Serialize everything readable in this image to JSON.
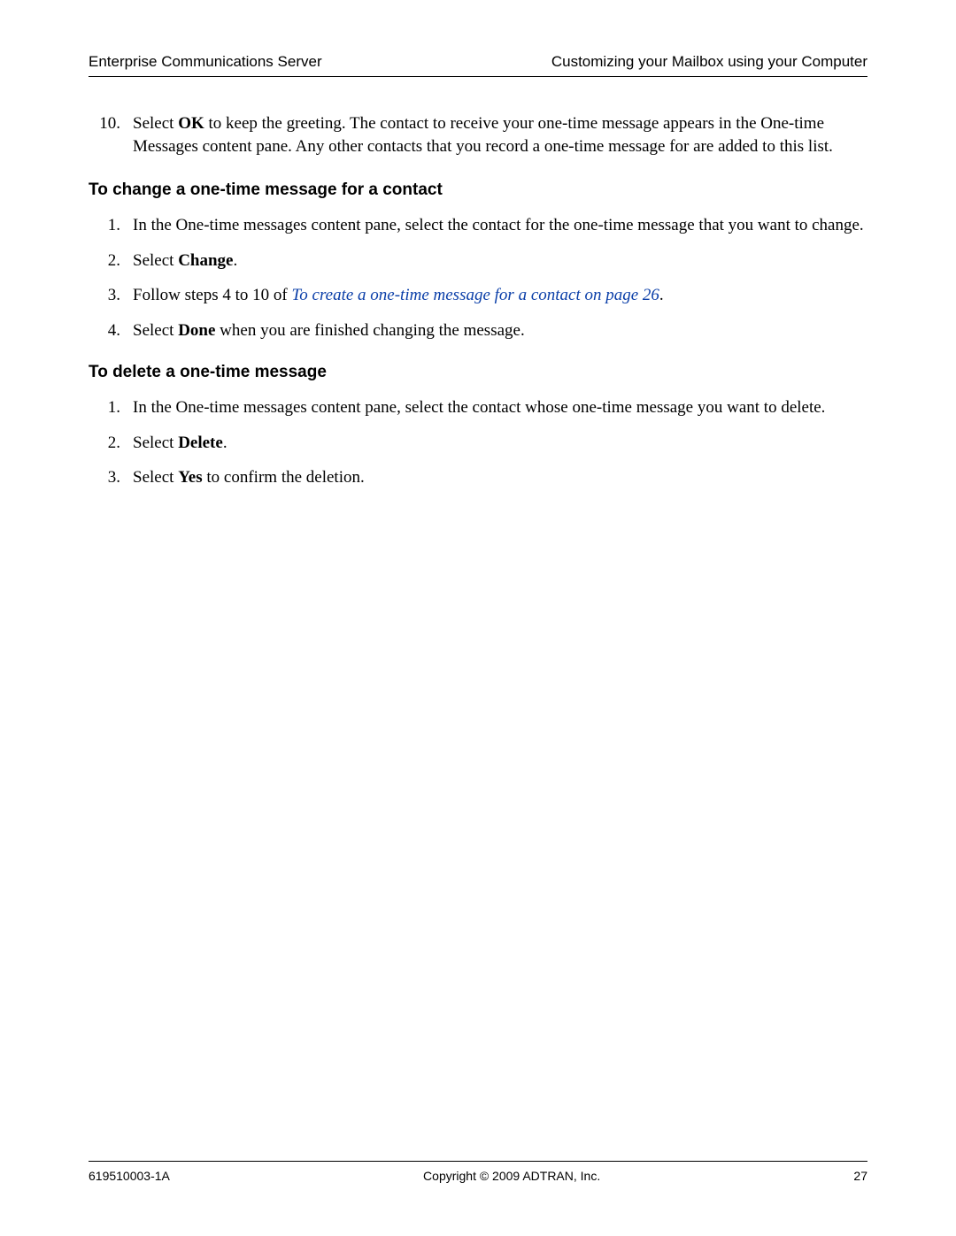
{
  "header": {
    "left": "Enterprise Communications Server",
    "right": "Customizing your Mailbox using your Computer"
  },
  "step10": {
    "num": "10.",
    "prefix": "Select ",
    "bold": "OK",
    "suffix": " to keep the greeting. The contact to receive your one-time message appears in the One-time Messages content pane. Any other contacts that you record a one-time message for are added to this list."
  },
  "section1": {
    "heading": "To change a one-time message for a contact",
    "items": [
      {
        "num": "1.",
        "text": "In the One-time messages content pane, select the contact for the one-time message that you want to change."
      },
      {
        "num": "2.",
        "prefix": "Select ",
        "bold": "Change",
        "suffix": "."
      },
      {
        "num": "3.",
        "prefix": "Follow steps 4 to 10 of ",
        "link": "To create a one-time message for a contact on page 26",
        "suffix": "."
      },
      {
        "num": "4.",
        "prefix": "Select ",
        "bold": "Done",
        "suffix": " when you are finished changing the message."
      }
    ]
  },
  "section2": {
    "heading": "To delete a one-time message",
    "items": [
      {
        "num": "1.",
        "text": "In the One-time messages content pane, select the contact whose one-time message you want to delete."
      },
      {
        "num": "2.",
        "prefix": "Select ",
        "bold": "Delete",
        "suffix": "."
      },
      {
        "num": "3.",
        "prefix": "Select ",
        "bold": "Yes",
        "suffix": " to confirm the deletion."
      }
    ]
  },
  "footer": {
    "left": "619510003-1A",
    "center": "Copyright © 2009 ADTRAN, Inc.",
    "right": "27"
  }
}
